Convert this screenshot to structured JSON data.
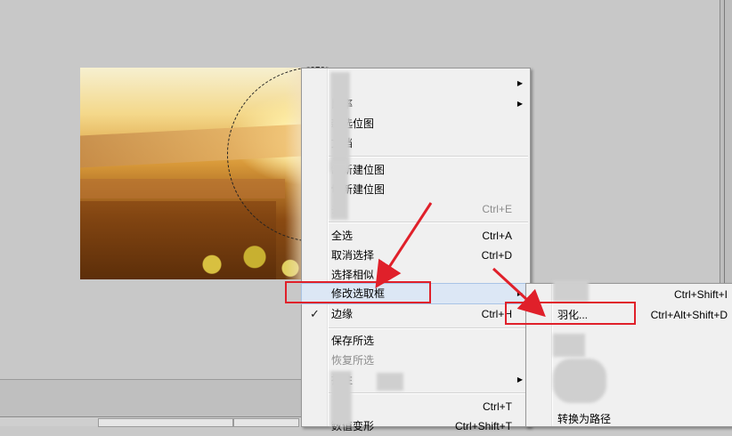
{
  "main_menu": {
    "items": [
      {
        "label": "",
        "shortcut": "",
        "submenu": true
      },
      {
        "label": "比率",
        "shortcut": "",
        "submenu": true
      },
      {
        "label": "新选位图",
        "shortcut": "",
        "submenu": false
      },
      {
        "label": "文档",
        "shortcut": "",
        "submenu": false
      },
      {
        "label": "制新建位图",
        "shortcut": "",
        "submenu": false
      },
      {
        "label": "切新建位图",
        "shortcut": "",
        "submenu": false
      },
      {
        "label": "并",
        "shortcut": "Ctrl+E",
        "disabled": true
      },
      {
        "label": "全选",
        "shortcut": "Ctrl+A"
      },
      {
        "label": "取消选择",
        "shortcut": "Ctrl+D"
      },
      {
        "label": "选择相似",
        "shortcut": ""
      },
      {
        "label": "修改选取框",
        "shortcut": "",
        "submenu": true,
        "highlighted": true
      },
      {
        "label": "边缘",
        "shortcut": "Ctrl+H",
        "checked": true
      },
      {
        "label": "保存所选",
        "shortcut": ""
      },
      {
        "label": "恢复所选",
        "shortcut": "",
        "disabled": true
      },
      {
        "label": "择性",
        "shortcut": "",
        "submenu": true
      },
      {
        "label": "",
        "shortcut": "Ctrl+T"
      },
      {
        "label": "数值变形",
        "shortcut": "Ctrl+Shift+T"
      }
    ]
  },
  "sub_menu": {
    "items": [
      {
        "label": "",
        "shortcut": "Ctrl+Shift+I"
      },
      {
        "label": "羽化...",
        "shortcut": "Ctrl+Alt+Shift+D"
      },
      {
        "label": "",
        "shortcut": ""
      },
      {
        "label": "",
        "shortcut": ""
      },
      {
        "label": "转换为路径",
        "shortcut": ""
      }
    ]
  },
  "annotation_color": "#e0202a",
  "icons": {
    "submenu_arrow": "chevron-right-icon",
    "check": "checkmark-icon"
  }
}
